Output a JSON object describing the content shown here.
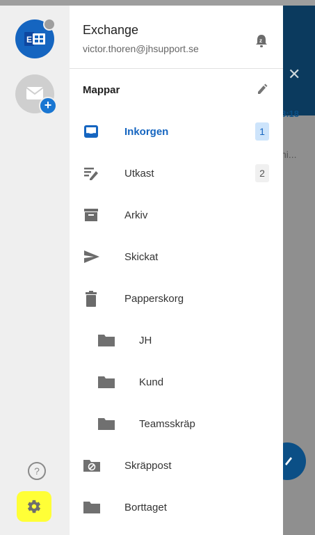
{
  "account": {
    "name": "Exchange",
    "email": "victor.thoren@jhsupport.se"
  },
  "section_title": "Mappar",
  "folders": [
    {
      "label": "Inkorgen",
      "count": "1",
      "icon": "inbox-icon",
      "active": true
    },
    {
      "label": "Utkast",
      "count": "2",
      "icon": "draft-icon"
    },
    {
      "label": "Arkiv",
      "icon": "archive-icon"
    },
    {
      "label": "Skickat",
      "icon": "send-icon"
    },
    {
      "label": "Papperskorg",
      "icon": "trash-icon"
    },
    {
      "label": "JH",
      "icon": "folder-icon"
    },
    {
      "label": "Kund",
      "icon": "folder-icon"
    },
    {
      "label": "Teamsskräp",
      "icon": "folder-icon"
    },
    {
      "label": "Skräppost",
      "icon": "spam-folder-icon"
    },
    {
      "label": "Borttaget",
      "icon": "folder-icon"
    }
  ],
  "background_app": {
    "time": "8:18",
    "snippet": "ni..."
  },
  "rail": {
    "help_label": "?"
  },
  "colors": {
    "accent": "#1565c0",
    "highlight": "#ffff37"
  }
}
